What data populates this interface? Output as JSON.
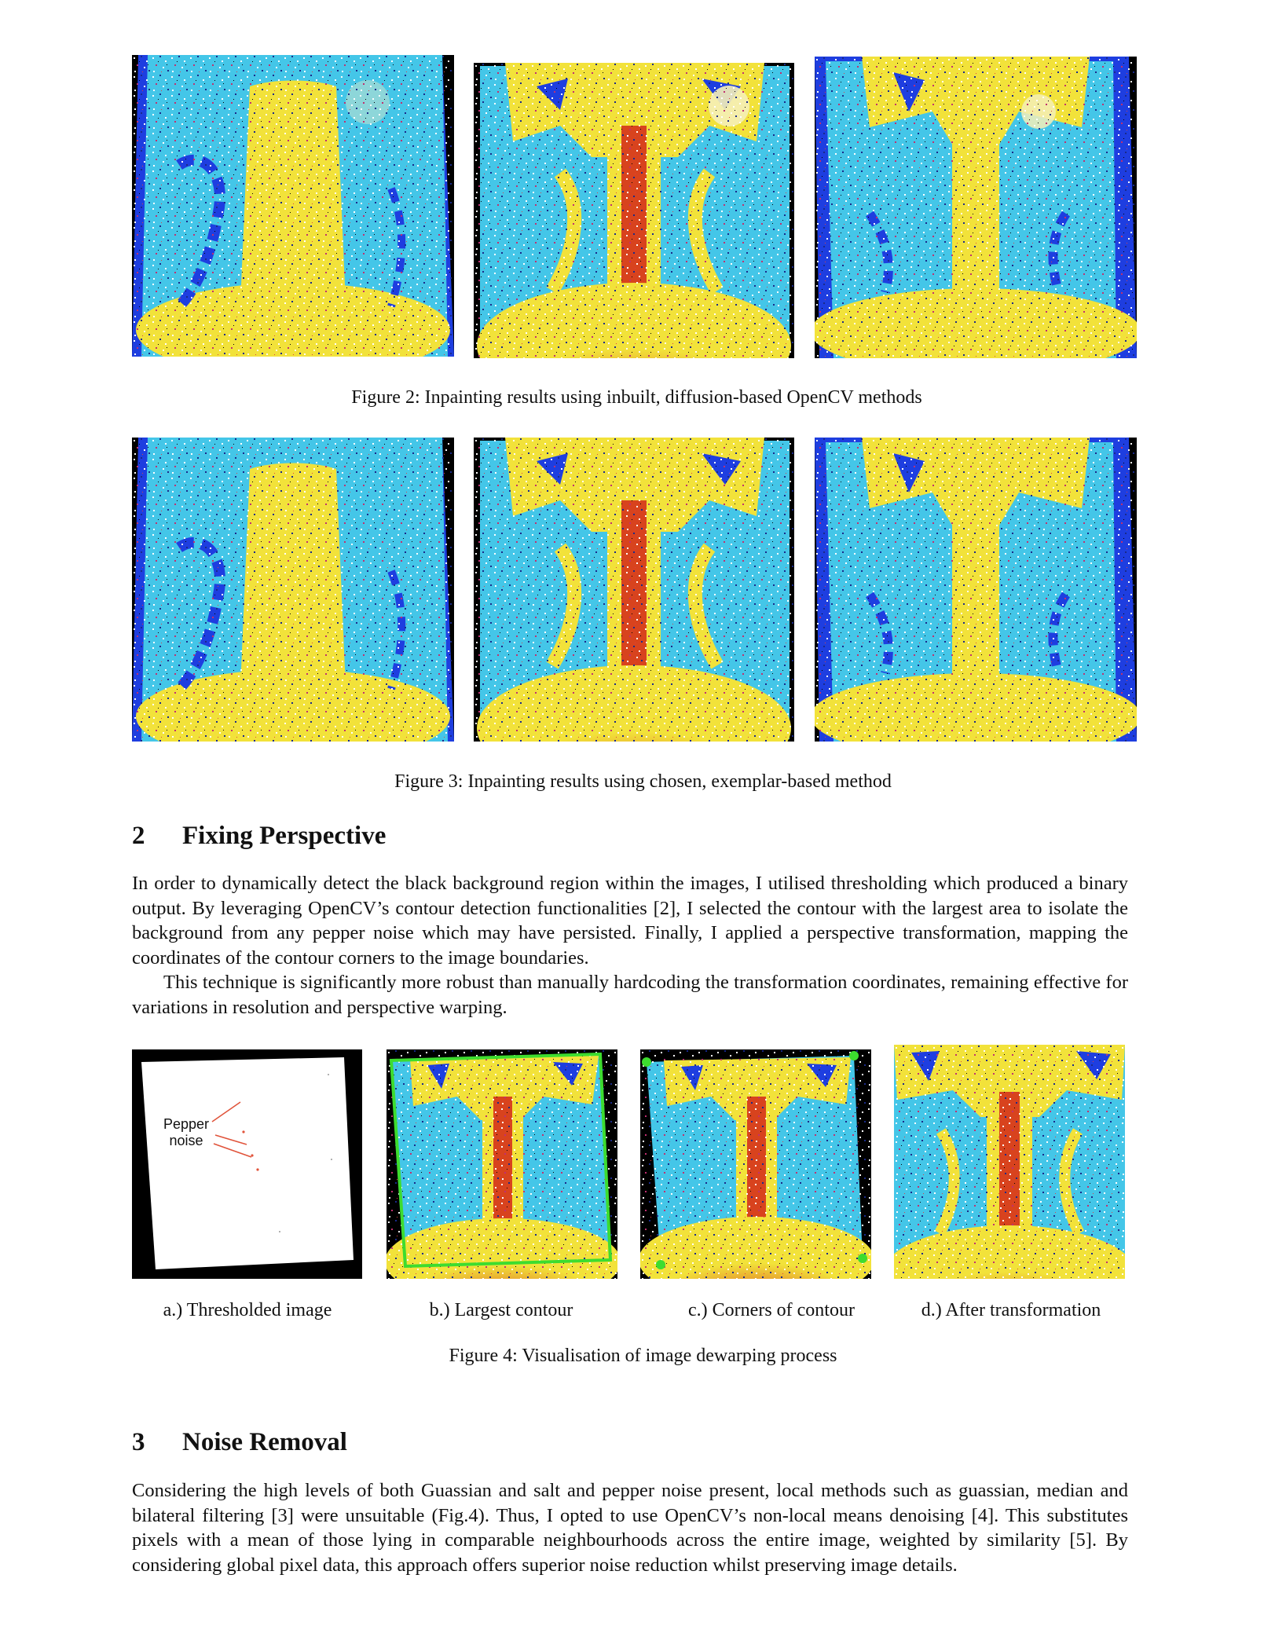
{
  "figure2": {
    "caption": "Figure 2: Inpainting results using inbuilt, diffusion-based OpenCV methods"
  },
  "figure3": {
    "caption": "Figure 3: Inpainting results using chosen, exemplar-based method"
  },
  "section2": {
    "number": "2",
    "title": "Fixing Perspective",
    "paragraph1": "In order to dynamically detect the black background region within the images, I utilised thresholding which produced a binary output. By leveraging OpenCV’s contour detection functionalities [2], I selected the contour with the largest area to isolate the background from any pepper noise which may have persisted. Finally, I applied a perspective transformation, mapping the coordinates of the contour corners to the image boundaries.",
    "paragraph2": "This technique is significantly more robust than manually hardcoding the transformation coordinates, remaining effective for variations in resolution and perspective warping."
  },
  "figure4": {
    "caption": "Figure 4: Visualisation of image dewarping process",
    "annotation": "Pepper noise",
    "subcaptions": [
      "a.) Thresholded image",
      "b.) Largest contour",
      "c.) Corners of contour",
      "d.) After transformation"
    ],
    "colors": {
      "arrow": "#e0533a",
      "contour": "#3ddc2f"
    }
  },
  "section3": {
    "number": "3",
    "title": "Noise Removal",
    "paragraph1": "Considering the high levels of both Guassian and salt and pepper noise present, local methods such as guassian, median and bilateral filtering [3] were unsuitable (Fig.4). Thus, I opted to use OpenCV’s non-local means denoising [4]. This substitutes pixels with a mean of those lying in comparable neighbourhoods across the entire image, weighted by similarity [5]. By considering global pixel data, this approach offers superior noise reduction whilst preserving image details."
  },
  "colors": {
    "bone_yellow": "#f2e23a",
    "lung_cyan": "#44c6e8",
    "edge_blue": "#1e3ee0",
    "spine_red": "#d8431e"
  }
}
